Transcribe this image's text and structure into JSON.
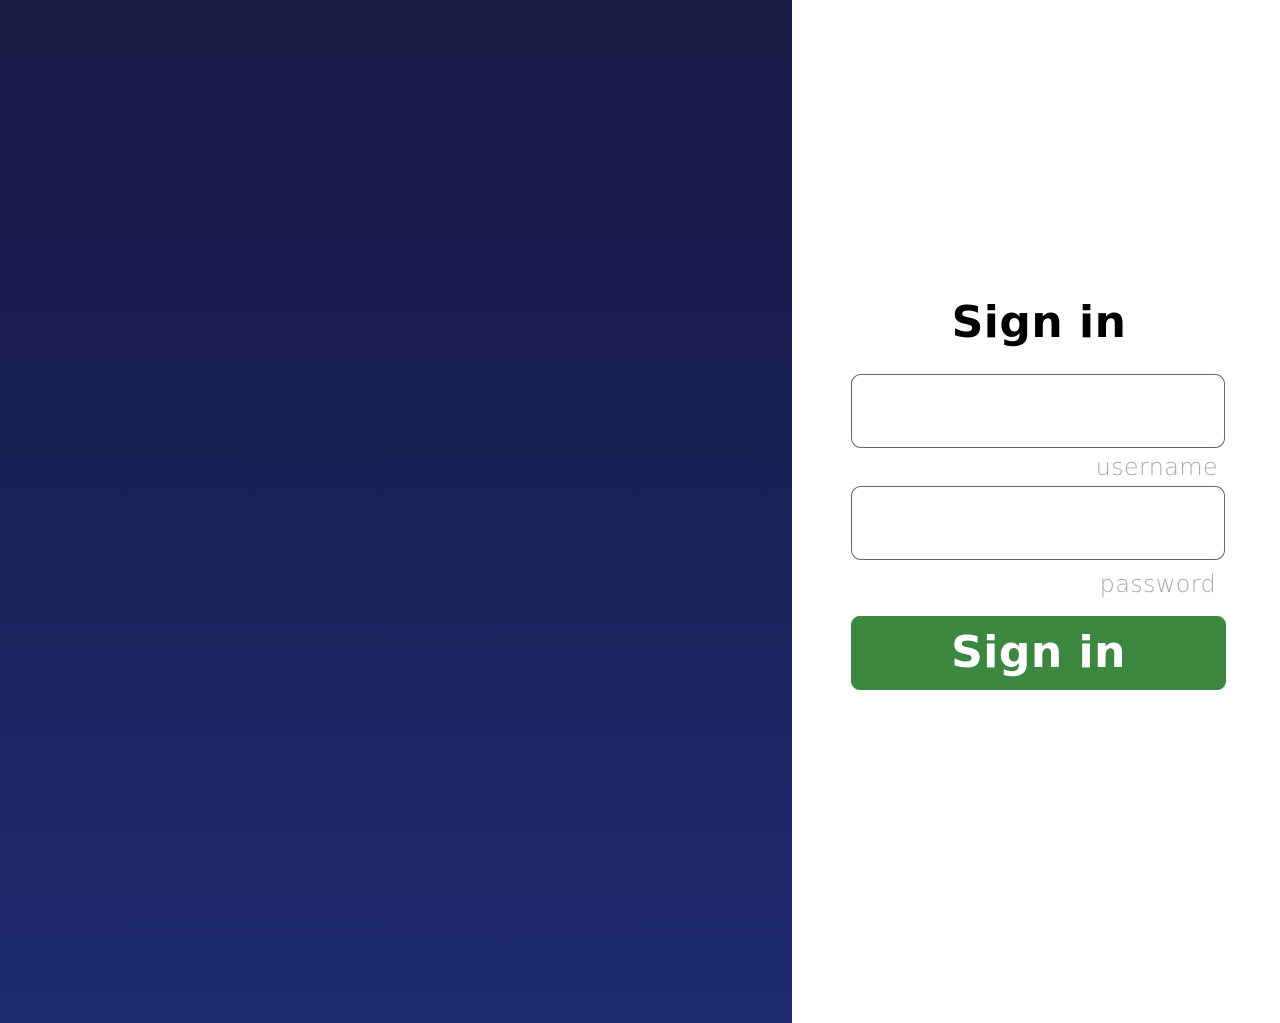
{
  "colors": {
    "hero_gradient_top": "#1a1d47",
    "hero_gradient_bottom": "#1e2b72",
    "form_background": "#ffffff",
    "submit_button": "#3c8841",
    "label_text": "#a9a9a9"
  },
  "form": {
    "title": "Sign in",
    "username": {
      "value": "",
      "label": "username"
    },
    "password": {
      "value": "",
      "label": "password"
    },
    "submit_label": "Sign in"
  }
}
